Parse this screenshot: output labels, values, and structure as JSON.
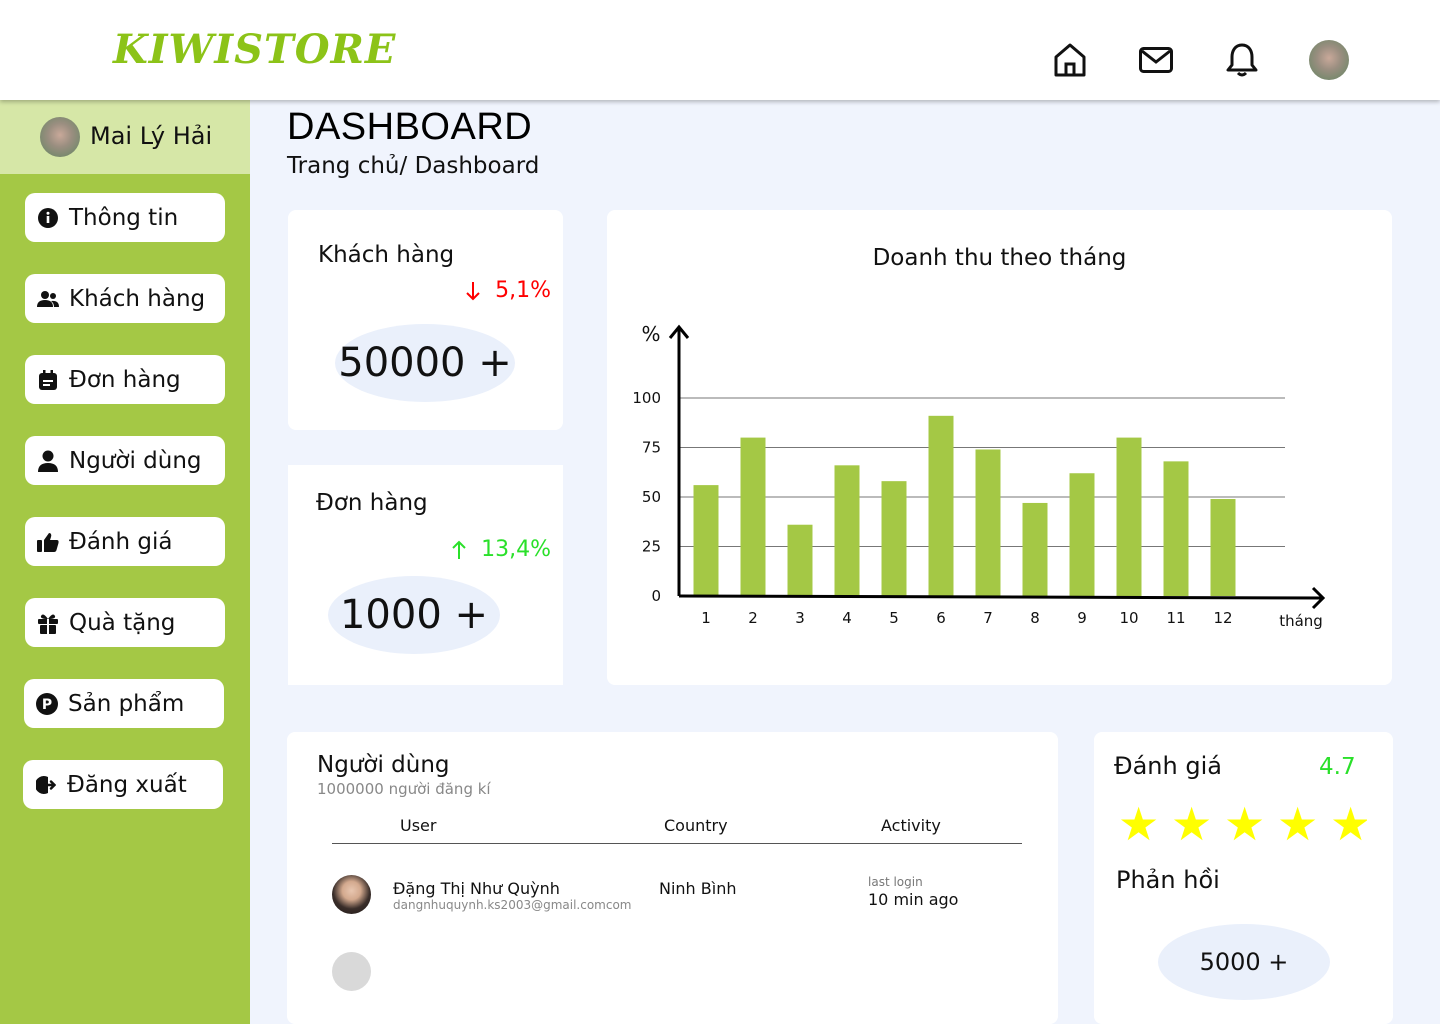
{
  "brand": {
    "name": "KIWISTORE"
  },
  "header_icons": [
    "home-icon",
    "mail-icon",
    "bell-icon",
    "profile-avatar"
  ],
  "sidebar": {
    "username": "Mai Lý Hải",
    "items": [
      {
        "label": "Thông tin",
        "icon": "info-icon"
      },
      {
        "label": "Khách hàng",
        "icon": "users-icon"
      },
      {
        "label": "Đơn hàng",
        "icon": "orders-icon"
      },
      {
        "label": "Người dùng",
        "icon": "user-icon"
      },
      {
        "label": "Đánh giá",
        "icon": "thumbs-up-icon"
      },
      {
        "label": "Quà tặng",
        "icon": "gift-icon"
      },
      {
        "label": "Sản phẩm",
        "icon": "product-icon"
      },
      {
        "label": "Đăng xuất",
        "icon": "logout-icon"
      }
    ]
  },
  "page": {
    "title": "DASHBOARD",
    "breadcrumb": "Trang chủ/ Dashboard"
  },
  "stats": {
    "customers": {
      "title": "Khách hàng",
      "change": "5,1%",
      "direction": "down",
      "value": "50000 +",
      "color": "#ff0000"
    },
    "orders": {
      "title": "Đơn hàng",
      "change": "13,4%",
      "direction": "up",
      "value": "1000 +",
      "color": "#2ae02a"
    }
  },
  "chart_data": {
    "type": "bar",
    "title": "Doanh thu theo tháng",
    "ylabel": "%",
    "xlabel": "tháng",
    "categories": [
      "1",
      "2",
      "3",
      "4",
      "5",
      "6",
      "7",
      "8",
      "9",
      "10",
      "11",
      "12"
    ],
    "values": [
      56,
      80,
      36,
      66,
      58,
      91,
      74,
      47,
      62,
      80,
      68,
      49
    ],
    "ylim": [
      0,
      100
    ],
    "yticks": [
      0,
      25,
      50,
      75,
      100
    ],
    "grid": true,
    "bar_color": "#a4c845"
  },
  "users": {
    "title": "Người dùng",
    "subtitle": "1000000 người đăng kí",
    "columns": [
      "User",
      "Country",
      "Activity"
    ],
    "rows": [
      {
        "name": "Đặng Thị Như Quỳnh",
        "email": "dangnhuquynh.ks2003@gmail.comcom",
        "country": "Ninh Bình",
        "activity_label": "last login",
        "activity_value": "10 min ago"
      }
    ]
  },
  "rating": {
    "title": "Đánh giá",
    "score": "4.7",
    "stars": 4.7,
    "feedback_title": "Phản hồi",
    "feedback_count": "5000 +"
  }
}
